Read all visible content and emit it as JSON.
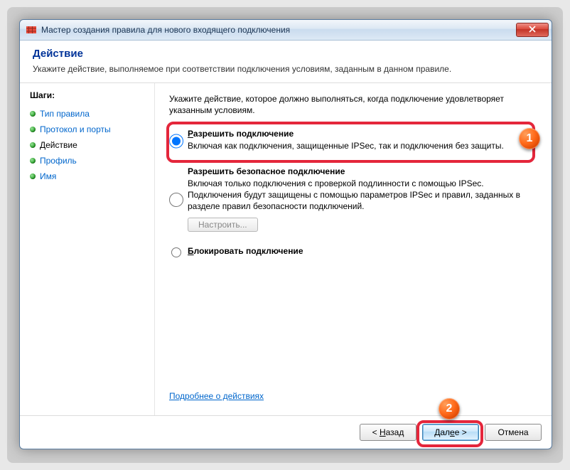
{
  "window": {
    "title": "Мастер создания правила для нового входящего подключения"
  },
  "header": {
    "title": "Действие",
    "subtitle": "Укажите действие, выполняемое при соответствии подключения условиям, заданным в данном правиле."
  },
  "sidebar": {
    "title": "Шаги:",
    "steps": [
      {
        "label": "Тип правила",
        "current": false
      },
      {
        "label": "Протокол и порты",
        "current": false
      },
      {
        "label": "Действие",
        "current": true
      },
      {
        "label": "Профиль",
        "current": false
      },
      {
        "label": "Имя",
        "current": false
      }
    ]
  },
  "content": {
    "description": "Укажите действие, которое должно выполняться, когда подключение удовлетворяет указанным условиям.",
    "options": [
      {
        "id": "allow",
        "title_prefix": "Р",
        "title_rest": "азрешить подключение",
        "desc": "Включая как подключения, защищенные IPSec, так и подключения без защиты.",
        "checked": true
      },
      {
        "id": "allow_secure",
        "title_prefix": "",
        "title_rest": "Разрешить безопасное подключение",
        "desc": "Включая только подключения с проверкой подлинности с помощью IPSec. Подключения будут защищены с помощью параметров IPSec и правил, заданных в разделе правил безопасности подключений.",
        "checked": false,
        "has_config": true,
        "config_label": "Настроить..."
      },
      {
        "id": "block",
        "title_prefix": "Б",
        "title_rest": "локировать подключение",
        "desc": "",
        "checked": false
      }
    ],
    "learn_more": "Подробнее о действиях"
  },
  "footer": {
    "back_prefix": "< ",
    "back_acc": "Н",
    "back_rest": "азад",
    "next_prefix": "Дал",
    "next_acc": "е",
    "next_rest": "е >",
    "cancel": "Отмена"
  },
  "markers": {
    "m1": "1",
    "m2": "2"
  }
}
